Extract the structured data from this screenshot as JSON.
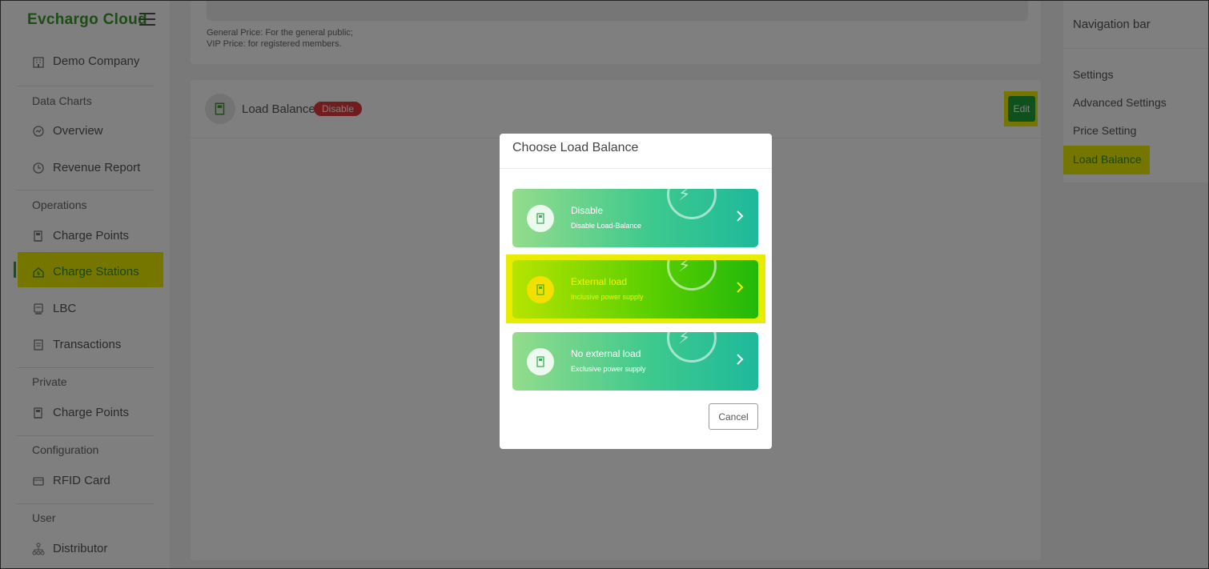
{
  "brand": {
    "name": "Evchargo Cloud"
  },
  "sidebar": {
    "company": "Demo Company",
    "sections": {
      "data_charts": "Data Charts",
      "operations": "Operations",
      "private": "Private",
      "configuration": "Configuration",
      "user": "User"
    },
    "items": {
      "overview": "Overview",
      "revenue_report": "Revenue Report",
      "charge_points": "Charge Points",
      "charge_stations": "Charge Stations",
      "lbc": "LBC",
      "transactions": "Transactions",
      "private_charge_points": "Charge Points",
      "rfid_card": "RFID Card",
      "distributor": "Distributor"
    },
    "active_item": "Charge Stations"
  },
  "main": {
    "price_note_general": "General Price: For the general public;",
    "price_note_vip": "VIP Price: for registered members.",
    "load_balance": {
      "title": "Load Balance",
      "status": "Disable",
      "edit_label": "Edit"
    }
  },
  "right_nav": {
    "title": "Navigation bar",
    "items": [
      "Settings",
      "Advanced Settings",
      "Price Setting",
      "Load Balance"
    ],
    "active": "Load Balance"
  },
  "modal": {
    "title": "Choose Load Balance",
    "options": [
      {
        "title": "Disable",
        "subtitle": "Disable Load-Balance"
      },
      {
        "title": "External load",
        "subtitle": "Inclusive power supply"
      },
      {
        "title": "No external load",
        "subtitle": "Exclusive power supply"
      }
    ],
    "highlighted_option": "External load",
    "cancel_label": "Cancel"
  },
  "colors": {
    "brand": "#3a9a2a",
    "highlight": "#e8ec00",
    "edit_button": "#21a13a",
    "disable_badge": "#e23b3b"
  }
}
